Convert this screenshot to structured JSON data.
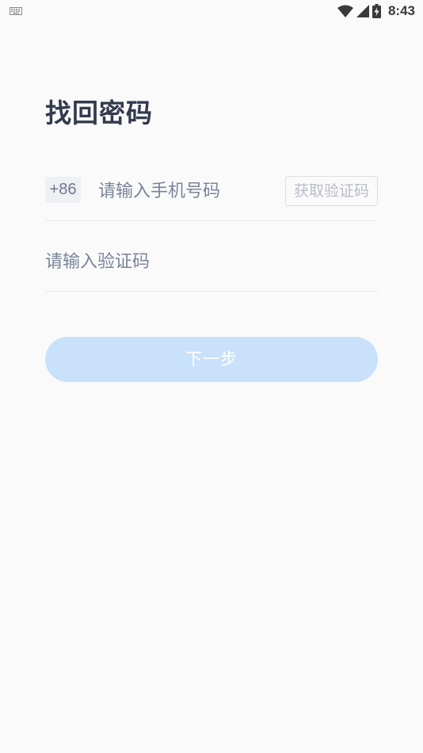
{
  "status_bar": {
    "time": "8:43",
    "icons": [
      "keyboard-icon",
      "wifi-icon",
      "signal-icon",
      "battery-charging-icon"
    ]
  },
  "page": {
    "title": "找回密码"
  },
  "phone_row": {
    "country_code": "+86",
    "placeholder": "请输入手机号码",
    "value": "",
    "get_code_label": "获取验证码"
  },
  "code_row": {
    "placeholder": "请输入验证码",
    "value": ""
  },
  "actions": {
    "next_label": "下一步"
  },
  "colors": {
    "background": "#fafafb",
    "title": "#333a4d",
    "primary_disabled": "#c9e1fb",
    "placeholder": "#7a8499"
  }
}
